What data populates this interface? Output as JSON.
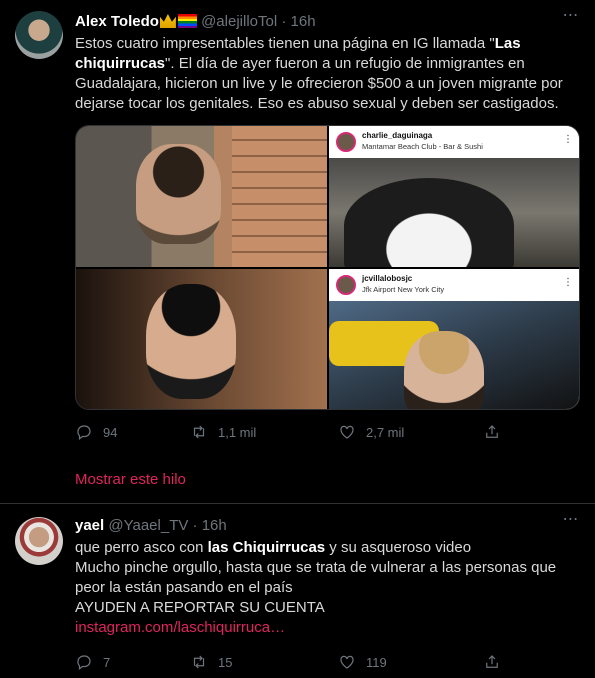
{
  "tweet1": {
    "name": "Alex Toledo",
    "emoji_crown": "👑",
    "emoji_rainbow": "🏳️‍🌈",
    "handle": "@alejilloTol",
    "sep": " · ",
    "time": "16h",
    "text_a": "Estos cuatro impresentables tienen una página en IG llamada \"",
    "text_b": "Las chiquirrucas",
    "text_c": "\". El día de ayer fueron a un refugio de inmigrantes en Guadalajara, hicieron un live y le ofrecieron $500 a un joven migrante por dejarse tocar los genitales. Eso es abuso sexual y deben ser castigados.",
    "media": [
      {
        "username": "charlie_daguinaga",
        "location": "Mantamar Beach Club - Bar & Sushi"
      },
      {
        "username": "jcvillalobosjc",
        "location": "Jfk Airport New York City"
      }
    ],
    "replies": "94",
    "retweets": "1,1 mil",
    "likes": "2,7 mil",
    "thread_link": "Mostrar este hilo"
  },
  "tweet2": {
    "name": "yael",
    "handle": "@Yaael_TV",
    "sep": " · ",
    "time": "16h",
    "line1_a": "que perro asco con ",
    "line1_b": "las Chiquirrucas",
    "line1_c": " y su asqueroso video",
    "line2": "Mucho pinche orgullo, hasta que se trata de vulnerar a las personas que peor la están pasando en el país",
    "line3": "AYUDEN A REPORTAR SU CUENTA",
    "link": "instagram.com/laschiquirruca…",
    "replies": "7",
    "retweets": "15",
    "likes": "119"
  },
  "icons": {
    "reply": "reply-icon",
    "retweet": "retweet-icon",
    "like": "heart-icon",
    "share": "share-icon",
    "more": "more-icon"
  },
  "colors": {
    "background": "#000000",
    "accent": "#e0245e",
    "muted": "#6e767d"
  }
}
